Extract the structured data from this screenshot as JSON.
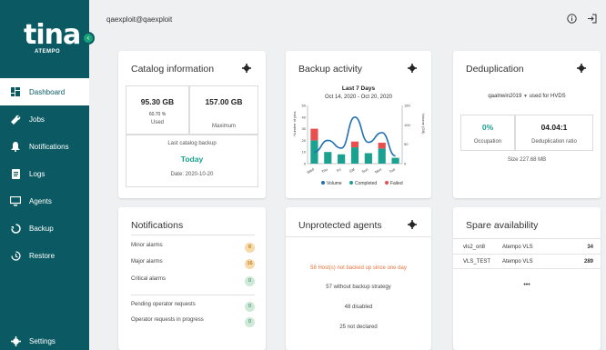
{
  "brand": {
    "name": "tina",
    "sub": "ATEMPO"
  },
  "user": "qaexploit@qaexploit",
  "nav": [
    {
      "label": "Dashboard",
      "icon": "dashboard-icon"
    },
    {
      "label": "Jobs",
      "icon": "wrench-icon"
    },
    {
      "label": "Notifications",
      "icon": "bell-icon"
    },
    {
      "label": "Logs",
      "icon": "document-icon"
    },
    {
      "label": "Agents",
      "icon": "monitor-icon"
    },
    {
      "label": "Backup",
      "icon": "backup-icon"
    },
    {
      "label": "Restore",
      "icon": "restore-icon"
    }
  ],
  "settings_label": "Settings",
  "catalog": {
    "title": "Catalog information",
    "used_value": "95.30 GB",
    "used_percent": "60.70 %",
    "used_label": "Used",
    "max_value": "157.00 GB",
    "max_label": "Maximum",
    "last_label": "Last catalog backup",
    "last_value": "Today",
    "date": "Date: 2020-10-20"
  },
  "backup": {
    "title": "Backup activity",
    "chart_title": "Last 7 Days",
    "range": "Oct 14, 2020 - Oct 20, 2020",
    "y_left_label": "Number of jobs",
    "y_right_label": "Volume (GB)",
    "legend": [
      "Volume",
      "Completed",
      "Failed"
    ]
  },
  "chart_data": {
    "type": "bar",
    "title": "Last 7 Days",
    "subtitle": "Oct 14, 2020 - Oct 20, 2020",
    "categories": [
      "Wed",
      "Thu",
      "Fri",
      "Sat",
      "Sun",
      "Mon",
      "Tue"
    ],
    "ylabel": "Number of jobs",
    "y2label": "Volume (GB)",
    "ylim": [
      0,
      50
    ],
    "y_ticks": [
      0,
      10,
      20,
      30,
      40,
      50
    ],
    "y2lim": [
      0,
      150
    ],
    "y2_ticks": [
      0,
      50,
      100,
      150
    ],
    "series": [
      {
        "name": "Completed",
        "type": "bar",
        "values": [
          20,
          10,
          8,
          14,
          9,
          13,
          5
        ]
      },
      {
        "name": "Failed",
        "type": "bar",
        "values": [
          10,
          0,
          0,
          5,
          0,
          5,
          0
        ]
      },
      {
        "name": "Volume",
        "type": "line",
        "values": [
          30,
          60,
          40,
          120,
          55,
          80,
          20
        ]
      }
    ],
    "colors": {
      "Volume": "#1f6fb2",
      "Completed": "#1aa18f",
      "Failed": "#e84f4f"
    }
  },
  "dedup": {
    "title": "Deduplication",
    "host": "qaalnwin2019",
    "host_suffix": "used for HVDS",
    "occupation_value": "0%",
    "occupation_label": "Occupation",
    "ratio_value": "04.04:1",
    "ratio_label": "Deduplication ratio",
    "size": "Size 227.68 MB"
  },
  "notifications": {
    "title": "Notifications",
    "rows": [
      {
        "label": "Minor alarms",
        "count": "8"
      },
      {
        "label": "Major alarms",
        "count": "16"
      },
      {
        "label": "Critical alarms",
        "count": "0"
      },
      {
        "label": "Pending operator requests",
        "count": "0"
      },
      {
        "label": "Operator requests in progress",
        "count": "0"
      }
    ]
  },
  "unprotected": {
    "title": "Unprotected agents",
    "warning": "58 Host(s) not backed up since one day",
    "lines": [
      "57 without backup strategy",
      "48 disabled",
      "25 not declared"
    ]
  },
  "spare": {
    "title": "Spare availability",
    "rows": [
      {
        "name": "vls2_on8",
        "type": "Atempo VLS",
        "count": "34"
      },
      {
        "name": "VLS_TEST",
        "type": "Atempo VLS",
        "count": "289"
      }
    ],
    "more": "•••"
  }
}
